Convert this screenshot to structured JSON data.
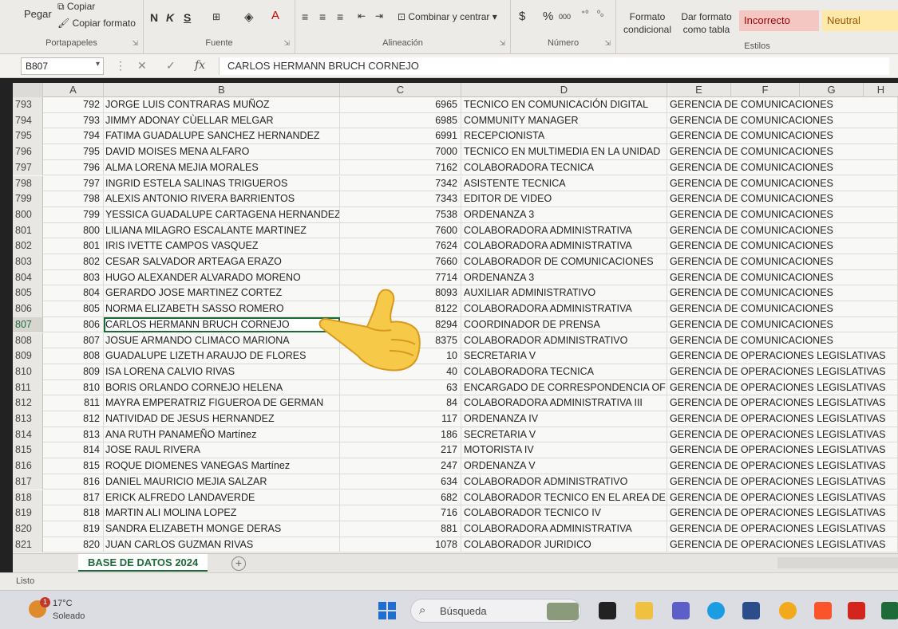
{
  "ribbon": {
    "clipboard": {
      "paste": "Pegar",
      "copy": "Copiar",
      "copy_format": "Copiar formato",
      "label": "Portapapeles"
    },
    "font": {
      "bold": "N",
      "italic": "K",
      "underline": "S",
      "label": "Fuente"
    },
    "alignment": {
      "merge": "Combinar y centrar",
      "label": "Alineación"
    },
    "number": {
      "currency": "$",
      "percent": "%",
      "thousands": "000",
      "label": "Número"
    },
    "styles": {
      "conditional": "Formato condicional",
      "as_table": "Dar formato como tabla",
      "incorrect": "Incorrecto",
      "neutral": "Neutral",
      "label": "Estilos"
    }
  },
  "formula_bar": {
    "cell_ref": "B807",
    "fx": "fx",
    "content": "CARLOS HERMANN BRUCH CORNEJO"
  },
  "columns": [
    "A",
    "B",
    "C",
    "D",
    "E",
    "F",
    "G",
    "H"
  ],
  "rows": [
    {
      "row": "793",
      "a": "792",
      "b": "JORGE LUIS CONTRARAS MUÑOZ",
      "c": "6965",
      "d": "TECNICO EN COMUNICACIÓN DIGITAL",
      "e": "GERENCIA DE COMUNICACIONES"
    },
    {
      "row": "794",
      "a": "793",
      "b": "JIMMY ADONAY CÙELLAR MELGAR",
      "c": "6985",
      "d": "COMMUNITY MANAGER",
      "e": "GERENCIA DE COMUNICACIONES"
    },
    {
      "row": "795",
      "a": "794",
      "b": "FATIMA GUADALUPE SANCHEZ HERNANDEZ",
      "c": "6991",
      "d": "RECEPCIONISTA",
      "e": "GERENCIA DE COMUNICACIONES"
    },
    {
      "row": "796",
      "a": "795",
      "b": "DAVID MOISES MENA ALFARO",
      "c": "7000",
      "d": "TECNICO EN MULTIMEDIA EN LA UNIDAD",
      "e": "GERENCIA DE COMUNICACIONES"
    },
    {
      "row": "797",
      "a": "796",
      "b": "ALMA LORENA MEJIA MORALES",
      "c": "7162",
      "d": "COLABORADORA TECNICA",
      "e": "GERENCIA DE COMUNICACIONES"
    },
    {
      "row": "798",
      "a": "797",
      "b": "INGRID ESTELA SALINAS TRIGUEROS",
      "c": "7342",
      "d": "ASISTENTE TECNICA",
      "e": "GERENCIA DE COMUNICACIONES"
    },
    {
      "row": "799",
      "a": "798",
      "b": "ALEXIS ANTONIO RIVERA BARRIENTOS",
      "c": "7343",
      "d": "EDITOR DE VIDEO",
      "e": "GERENCIA DE COMUNICACIONES"
    },
    {
      "row": "800",
      "a": "799",
      "b": "YESSICA GUADALUPE CARTAGENA HERNANDEZ",
      "c": "7538",
      "d": "ORDENANZA 3",
      "e": "GERENCIA DE COMUNICACIONES"
    },
    {
      "row": "801",
      "a": "800",
      "b": "LILIANA MILAGRO ESCALANTE MARTINEZ",
      "c": "7600",
      "d": "COLABORADORA ADMINISTRATIVA",
      "e": "GERENCIA DE COMUNICACIONES"
    },
    {
      "row": "802",
      "a": "801",
      "b": "IRIS IVETTE CAMPOS VASQUEZ",
      "c": "7624",
      "d": "COLABORADORA ADMINISTRATIVA",
      "e": "GERENCIA DE COMUNICACIONES"
    },
    {
      "row": "803",
      "a": "802",
      "b": "CESAR SALVADOR ARTEAGA ERAZO",
      "c": "7660",
      "d": "COLABORADOR DE COMUNICACIONES",
      "e": "GERENCIA DE COMUNICACIONES"
    },
    {
      "row": "804",
      "a": "803",
      "b": "HUGO ALEXANDER ALVARADO MORENO",
      "c": "7714",
      "d": "ORDENANZA 3",
      "e": "GERENCIA DE COMUNICACIONES"
    },
    {
      "row": "805",
      "a": "804",
      "b": "GERARDO JOSE MARTINEZ CORTEZ",
      "c": "8093",
      "d": "AUXILIAR ADMINISTRATIVO",
      "e": "GERENCIA DE COMUNICACIONES"
    },
    {
      "row": "806",
      "a": "805",
      "b": "NORMA ELIZABETH SASSO ROMERO",
      "c": "8122",
      "d": "COLABORADORA ADMINISTRATIVA",
      "e": "GERENCIA DE COMUNICACIONES"
    },
    {
      "row": "807",
      "a": "806",
      "b": "CARLOS HERMANN BRUCH CORNEJO",
      "c": "8294",
      "d": "COORDINADOR DE PRENSA",
      "e": "GERENCIA DE COMUNICACIONES",
      "active": true
    },
    {
      "row": "808",
      "a": "807",
      "b": "JOSUE ARMANDO CLIMACO MARIONA",
      "c": "8375",
      "d": "COLABORADOR ADMINISTRATIVO",
      "e": "GERENCIA DE COMUNICACIONES"
    },
    {
      "row": "809",
      "a": "808",
      "b": "GUADALUPE LIZETH ARAUJO DE FLORES",
      "c": "10",
      "d": "SECRETARIA V",
      "e": "GERENCIA DE OPERACIONES LEGISLATIVAS"
    },
    {
      "row": "810",
      "a": "809",
      "b": "ISA LORENA CALVIO RIVAS",
      "c": "40",
      "d": "COLABORADORA TECNICA",
      "e": "GERENCIA DE OPERACIONES LEGISLATIVAS"
    },
    {
      "row": "811",
      "a": "810",
      "b": "BORIS ORLANDO CORNEJO HELENA",
      "c": "63",
      "d": "ENCARGADO DE CORRESPONDENCIA OFIC",
      "e": "GERENCIA DE OPERACIONES LEGISLATIVAS"
    },
    {
      "row": "812",
      "a": "811",
      "b": "MAYRA EMPERATRIZ FIGUEROA DE GERMAN",
      "c": "84",
      "d": "COLABORADORA ADMINISTRATIVA III",
      "e": "GERENCIA DE OPERACIONES LEGISLATIVAS"
    },
    {
      "row": "813",
      "a": "812",
      "b": "NATIVIDAD DE JESUS HERNANDEZ",
      "c": "117",
      "d": "ORDENANZA IV",
      "e": "GERENCIA DE OPERACIONES LEGISLATIVAS"
    },
    {
      "row": "814",
      "a": "813",
      "b": "ANA RUTH PANAMEÑO Martínez",
      "c": "186",
      "d": "SECRETARIA V",
      "e": "GERENCIA DE OPERACIONES LEGISLATIVAS"
    },
    {
      "row": "815",
      "a": "814",
      "b": "JOSE RAUL RIVERA",
      "c": "217",
      "d": "MOTORISTA IV",
      "e": "GERENCIA DE OPERACIONES LEGISLATIVAS"
    },
    {
      "row": "816",
      "a": "815",
      "b": "ROQUE DIOMENES VANEGAS Martínez",
      "c": "247",
      "d": "ORDENANZA V",
      "e": "GERENCIA DE OPERACIONES LEGISLATIVAS"
    },
    {
      "row": "817",
      "a": "816",
      "b": "DANIEL MAURICIO MEJIA SALZAR",
      "c": "634",
      "d": "COLABORADOR ADMINISTRATIVO",
      "e": "GERENCIA DE OPERACIONES LEGISLATIVAS"
    },
    {
      "row": "818",
      "a": "817",
      "b": "ERICK ALFREDO LANDAVERDE",
      "c": "682",
      "d": "COLABORADOR TECNICO EN EL AREA DE L",
      "e": "GERENCIA DE OPERACIONES LEGISLATIVAS"
    },
    {
      "row": "819",
      "a": "818",
      "b": "MARTIN ALI MOLINA LOPEZ",
      "c": "716",
      "d": "COLABORADOR TECNICO IV",
      "e": "GERENCIA DE OPERACIONES LEGISLATIVAS"
    },
    {
      "row": "820",
      "a": "819",
      "b": "SANDRA ELIZABETH MONGE DERAS",
      "c": "881",
      "d": "COLABORADORA ADMINISTRATIVA",
      "e": "GERENCIA DE OPERACIONES LEGISLATIVAS"
    },
    {
      "row": "821",
      "a": "820",
      "b": "JUAN CARLOS GUZMAN RIVAS",
      "c": "1078",
      "d": "COLABORADOR JURIDICO",
      "e": "GERENCIA DE OPERACIONES LEGISLATIVAS"
    }
  ],
  "sheet_tab": "BASE DE DATOS 2024",
  "status": "Listo",
  "taskbar": {
    "temperature": "17°C",
    "condition": "Soleado",
    "badge": "1",
    "search": "Búsqueda"
  },
  "colors": {
    "accent": "#1e6b3a",
    "incorrect_bg": "#f4c7c3",
    "incorrect_fg": "#9c0006",
    "neutral_bg": "#ffe9a8",
    "neutral_fg": "#9c5700"
  }
}
